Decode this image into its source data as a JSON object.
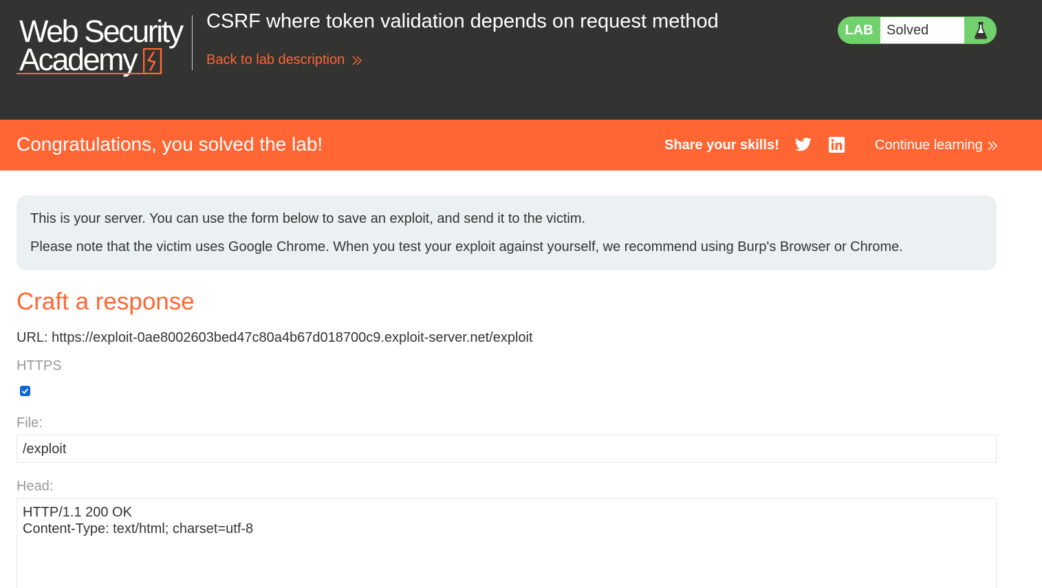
{
  "header": {
    "logo_line1": "Web Security",
    "logo_line2": "Academy",
    "lab_title": "CSRF where token validation depends on request method",
    "back_link": "Back to lab description",
    "status_tag": "LAB",
    "status_value": "Solved"
  },
  "banner": {
    "congrats": "Congratulations, you solved the lab!",
    "share_label": "Share your skills!",
    "continue_link": "Continue learning"
  },
  "info": {
    "line1": "This is your server. You can use the form below to save an exploit, and send it to the victim.",
    "line2": "Please note that the victim uses Google Chrome. When you test your exploit against yourself, we recommend using Burp's Browser or Chrome."
  },
  "form": {
    "heading": "Craft a response",
    "url_text": "URL: https://exploit-0ae8002603bed47c80a4b67d018700c9.exploit-server.net/exploit",
    "https_label": "HTTPS",
    "https_checked": true,
    "file_label": "File:",
    "file_value": "/exploit",
    "head_label": "Head:",
    "head_line1": "HTTP/1.1 200 OK",
    "head_line2": "Content-Type: text/html; charset=utf-8"
  },
  "colors": {
    "header_bg": "#333332",
    "accent": "#ff6633",
    "solved_green": "#70d16d",
    "info_bg": "#ebf0f2",
    "checkbox_blue": "#0b66d6"
  },
  "icons": [
    "academy-logo-icon",
    "chevron-right-icon",
    "flask-icon",
    "twitter-icon",
    "linkedin-icon",
    "checkmark-icon"
  ]
}
